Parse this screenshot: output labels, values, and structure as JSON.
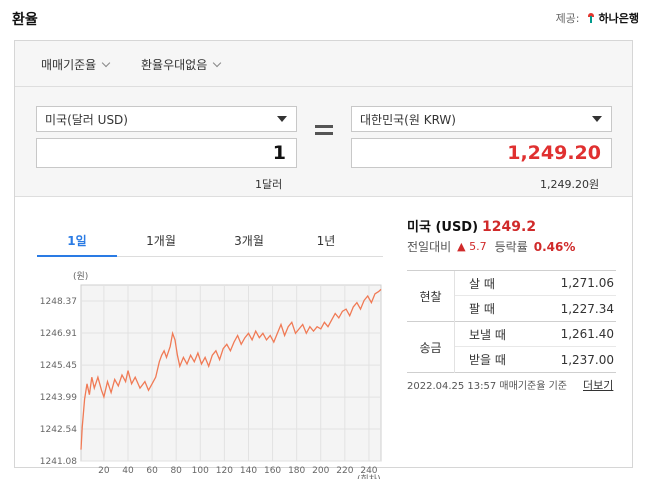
{
  "header": {
    "title": "환율",
    "provider_label": "제공:",
    "provider_name": "하나은행"
  },
  "filters": {
    "rate_type": "매매기준율",
    "preferential": "환율우대없음"
  },
  "converter": {
    "from_currency": "미국(달러 USD)",
    "from_amount": "1",
    "from_caption": "1달러",
    "to_currency": "대한민국(원 KRW)",
    "to_amount": "1,249.20",
    "to_caption": "1,249.20원"
  },
  "tabs": [
    "1일",
    "1개월",
    "3개월",
    "1년"
  ],
  "active_tab": 0,
  "summary": {
    "country": "미국 (USD)",
    "rate": "1249.2",
    "change_label": "전일대비",
    "change_arrow": "▲",
    "change_value": "5.7",
    "change_rate_label": "등락률",
    "change_rate": "0.46%"
  },
  "rate_table": [
    {
      "group": "현찰",
      "rows": [
        {
          "label": "살 때",
          "value": "1,271.06"
        },
        {
          "label": "팔 때",
          "value": "1,227.34"
        }
      ]
    },
    {
      "group": "송금",
      "rows": [
        {
          "label": "보낼 때",
          "value": "1,261.40"
        },
        {
          "label": "받을 때",
          "value": "1,237.00"
        }
      ]
    }
  ],
  "footer": {
    "timestamp": "2022.04.25 13:57  매매기준율 기준",
    "more_link": "더보기"
  },
  "colors": {
    "accent_blue": "#2a7be4",
    "up_red": "#d02a2a",
    "line_orange": "#f07a55"
  },
  "chart_data": {
    "type": "line",
    "ylabel": "(원)",
    "xlabel": "(회차)",
    "y_ticks": [
      "1248.37",
      "1246.91",
      "1245.45",
      "1243.99",
      "1242.54",
      "1241.08"
    ],
    "x_ticks": [
      20,
      40,
      60,
      80,
      100,
      120,
      140,
      160,
      180,
      200,
      220,
      240
    ],
    "xlim": [
      1,
      250
    ],
    "ylim": [
      1241.08,
      1249.1
    ],
    "series": [
      {
        "values": [
          [
            1,
            1241.6
          ],
          [
            2,
            1242.6
          ],
          [
            4,
            1243.9
          ],
          [
            6,
            1244.6
          ],
          [
            8,
            1244.1
          ],
          [
            10,
            1244.9
          ],
          [
            12,
            1244.4
          ],
          [
            15,
            1244.9
          ],
          [
            18,
            1244.3
          ],
          [
            20,
            1244.0
          ],
          [
            23,
            1244.7
          ],
          [
            26,
            1244.2
          ],
          [
            29,
            1244.8
          ],
          [
            32,
            1244.5
          ],
          [
            35,
            1245.0
          ],
          [
            38,
            1244.7
          ],
          [
            40,
            1245.2
          ],
          [
            43,
            1244.6
          ],
          [
            46,
            1244.9
          ],
          [
            50,
            1244.4
          ],
          [
            54,
            1244.7
          ],
          [
            57,
            1244.3
          ],
          [
            60,
            1244.6
          ],
          [
            63,
            1244.9
          ],
          [
            66,
            1245.6
          ],
          [
            68,
            1245.9
          ],
          [
            70,
            1246.1
          ],
          [
            72,
            1245.8
          ],
          [
            75,
            1246.3
          ],
          [
            77,
            1246.9
          ],
          [
            79,
            1246.6
          ],
          [
            81,
            1245.9
          ],
          [
            83,
            1245.4
          ],
          [
            86,
            1245.8
          ],
          [
            89,
            1245.5
          ],
          [
            92,
            1245.9
          ],
          [
            95,
            1245.6
          ],
          [
            98,
            1246.0
          ],
          [
            101,
            1245.5
          ],
          [
            104,
            1245.8
          ],
          [
            107,
            1245.4
          ],
          [
            110,
            1245.9
          ],
          [
            113,
            1246.1
          ],
          [
            116,
            1245.7
          ],
          [
            119,
            1246.2
          ],
          [
            122,
            1246.4
          ],
          [
            125,
            1246.1
          ],
          [
            128,
            1246.5
          ],
          [
            131,
            1246.8
          ],
          [
            134,
            1246.4
          ],
          [
            137,
            1246.7
          ],
          [
            140,
            1246.9
          ],
          [
            143,
            1246.6
          ],
          [
            146,
            1247.0
          ],
          [
            149,
            1246.7
          ],
          [
            152,
            1246.9
          ],
          [
            155,
            1246.6
          ],
          [
            158,
            1246.8
          ],
          [
            161,
            1246.5
          ],
          [
            164,
            1246.9
          ],
          [
            167,
            1247.3
          ],
          [
            170,
            1246.8
          ],
          [
            173,
            1247.2
          ],
          [
            176,
            1247.4
          ],
          [
            179,
            1246.9
          ],
          [
            182,
            1247.1
          ],
          [
            185,
            1247.3
          ],
          [
            188,
            1246.9
          ],
          [
            191,
            1247.2
          ],
          [
            194,
            1247.0
          ],
          [
            197,
            1247.2
          ],
          [
            200,
            1247.1
          ],
          [
            203,
            1247.4
          ],
          [
            206,
            1247.2
          ],
          [
            209,
            1247.5
          ],
          [
            212,
            1247.8
          ],
          [
            215,
            1247.6
          ],
          [
            218,
            1247.9
          ],
          [
            221,
            1248.0
          ],
          [
            224,
            1247.7
          ],
          [
            227,
            1248.1
          ],
          [
            230,
            1248.3
          ],
          [
            233,
            1248.0
          ],
          [
            236,
            1248.4
          ],
          [
            239,
            1248.6
          ],
          [
            242,
            1248.3
          ],
          [
            245,
            1248.7
          ],
          [
            248,
            1248.8
          ],
          [
            250,
            1248.9
          ]
        ]
      }
    ],
    "grid": true
  }
}
